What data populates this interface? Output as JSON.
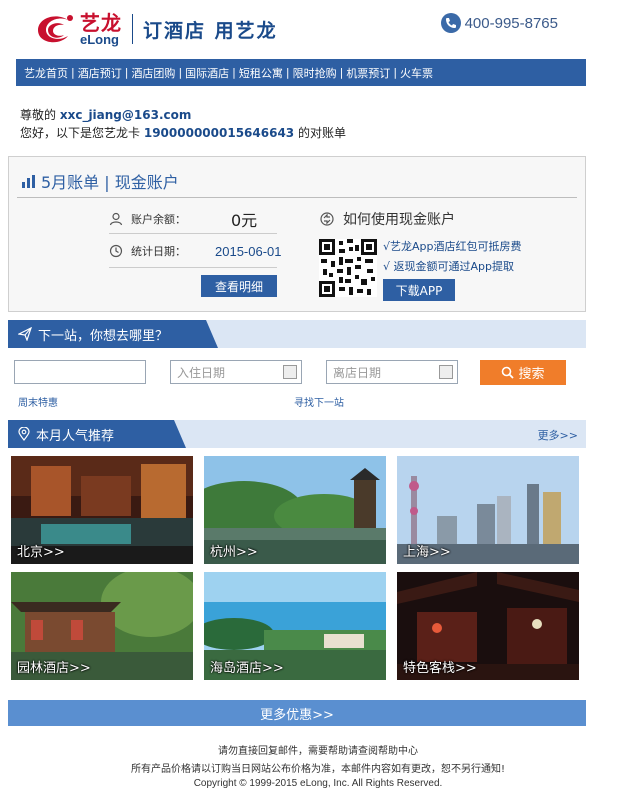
{
  "header": {
    "logo_cn": "艺龙",
    "logo_en": "eLong",
    "slogan": "订酒店 用艺龙",
    "hotline": "400-995-8765"
  },
  "nav": {
    "items": [
      "艺龙首页",
      "酒店预订",
      "酒店团购",
      "国际酒店",
      "短租公寓",
      "限时抢购",
      "机票预订",
      "火车票"
    ]
  },
  "greeting": {
    "prefix": "尊敬的",
    "email": "xxc_jiang@163.com",
    "line2_prefix": "您好，以下是您艺龙卡",
    "card_no": "190000000015646643",
    "line2_suffix": "的对账单"
  },
  "bill": {
    "title": "5月账单 | 现金账户",
    "balance_label": "账户余额：",
    "balance_value": "0元",
    "date_label": "统计日期：",
    "date_value": "2015-06-01",
    "detail_button": "查看明细",
    "howto_title": "如何使用现金账户",
    "tip1": "√艺龙App酒店红包可抵房费",
    "tip2": "√ 返现金额可通过App提取",
    "download_button": "下载APP"
  },
  "search": {
    "section_title": "下一站，你想去哪里？",
    "checkin_placeholder": "入住日期",
    "checkout_placeholder": "离店日期",
    "search_button": "搜索",
    "weekend_link": "周末特惠",
    "next_stop_link": "寻找下一站"
  },
  "popular": {
    "section_title": "本月人气推荐",
    "more_link": "更多>>",
    "tiles": [
      {
        "label": "北京>>"
      },
      {
        "label": "杭州>>"
      },
      {
        "label": "上海>>"
      },
      {
        "label": "园林酒店>>"
      },
      {
        "label": "海岛酒店>>"
      },
      {
        "label": "特色客栈>>"
      }
    ]
  },
  "footer": {
    "more_offers": "更多优惠>>",
    "line1": "请勿直接回复邮件，需要帮助请查阅帮助中心",
    "line2": "所有产品价格请以订购当日网站公布价格为准，本邮件内容如有更改，恕不另行通知!",
    "copyright": "Copyright © 1999-2015 eLong, Inc. All Rights Reserved."
  },
  "colors": {
    "brand_blue": "#2e5fa3",
    "brand_red": "#c8102e",
    "accent_orange": "#f07d2a"
  }
}
